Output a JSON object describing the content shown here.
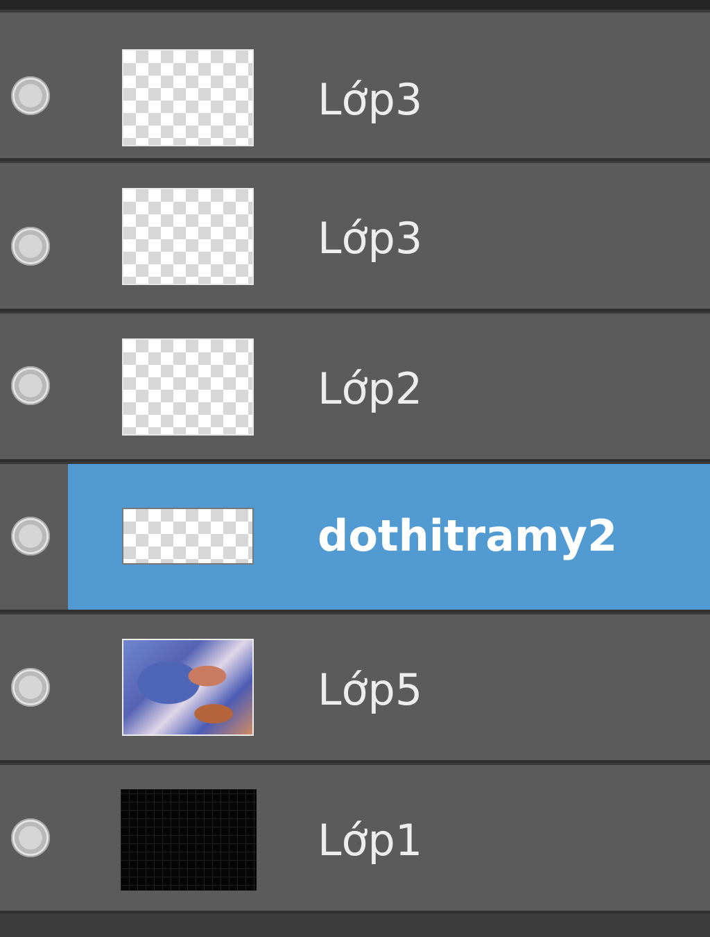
{
  "layers": [
    {
      "name": "Lớp3",
      "thumbnail": "transparent-checkerboard",
      "visible_icon": "eye-toggle-icon",
      "selected": false
    },
    {
      "name": "Lớp3",
      "thumbnail": "transparent-checkerboard",
      "visible_icon": "eye-toggle-icon",
      "selected": false
    },
    {
      "name": "Lớp2",
      "thumbnail": "transparent-checkerboard",
      "visible_icon": "eye-toggle-icon",
      "selected": false
    },
    {
      "name": "dothitramy2",
      "thumbnail": "transparent-checkerboard",
      "visible_icon": "eye-toggle-icon",
      "selected": true
    },
    {
      "name": "Lớp5",
      "thumbnail": "painted-artwork",
      "visible_icon": "eye-toggle-icon",
      "selected": false
    },
    {
      "name": "Lớp1",
      "thumbnail": "black-fill",
      "visible_icon": "eye-toggle-icon",
      "selected": false
    }
  ],
  "colors": {
    "row_background": "#5b5b5b",
    "selected_background": "#529bd2",
    "divider": "#2f2f2f",
    "label_text": "#ededed"
  }
}
